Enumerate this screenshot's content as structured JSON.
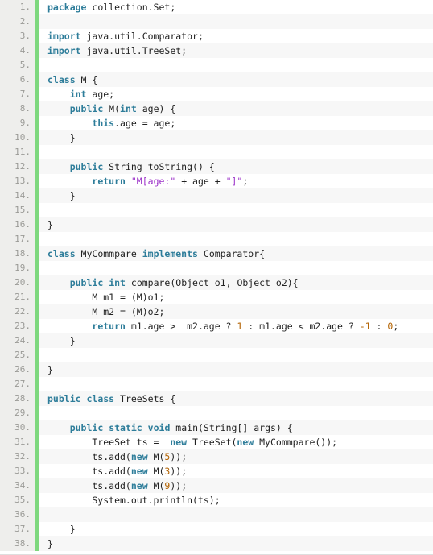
{
  "editor": {
    "language": "java",
    "line_number_suffix": ".",
    "colors": {
      "background": "#ffffff",
      "stripe": "#f7f7f7",
      "gutter_background": "#eeeeec",
      "gutter_text": "#9a9a96",
      "change_marker": "#7ed87e",
      "keyword": "#2e7d9a",
      "string": "#9b30c8",
      "number": "#b36200",
      "plain_text": "#222222"
    },
    "first_line": 1,
    "last_line": 38,
    "total_lines": 38
  },
  "lines": [
    {
      "n": "1.",
      "tokens": [
        {
          "t": "package",
          "c": "kw"
        },
        {
          "t": " collection.Set;",
          "c": "plain"
        }
      ]
    },
    {
      "n": "2.",
      "tokens": []
    },
    {
      "n": "3.",
      "tokens": [
        {
          "t": "import",
          "c": "kw"
        },
        {
          "t": " java.util.Comparator;",
          "c": "plain"
        }
      ]
    },
    {
      "n": "4.",
      "tokens": [
        {
          "t": "import",
          "c": "kw"
        },
        {
          "t": " java.util.TreeSet;",
          "c": "plain"
        }
      ]
    },
    {
      "n": "5.",
      "tokens": []
    },
    {
      "n": "6.",
      "tokens": [
        {
          "t": "class",
          "c": "kw"
        },
        {
          "t": " M {",
          "c": "plain"
        }
      ]
    },
    {
      "n": "7.",
      "tokens": [
        {
          "t": "    ",
          "c": "plain"
        },
        {
          "t": "int",
          "c": "kw"
        },
        {
          "t": " age;",
          "c": "plain"
        }
      ]
    },
    {
      "n": "8.",
      "tokens": [
        {
          "t": "    ",
          "c": "plain"
        },
        {
          "t": "public",
          "c": "kw"
        },
        {
          "t": " M(",
          "c": "plain"
        },
        {
          "t": "int",
          "c": "kw"
        },
        {
          "t": " age) {",
          "c": "plain"
        }
      ]
    },
    {
      "n": "9.",
      "tokens": [
        {
          "t": "        ",
          "c": "plain"
        },
        {
          "t": "this",
          "c": "kw"
        },
        {
          "t": ".age = age;",
          "c": "plain"
        }
      ]
    },
    {
      "n": "10.",
      "tokens": [
        {
          "t": "    }",
          "c": "plain"
        }
      ]
    },
    {
      "n": "11.",
      "tokens": []
    },
    {
      "n": "12.",
      "tokens": [
        {
          "t": "    ",
          "c": "plain"
        },
        {
          "t": "public",
          "c": "kw"
        },
        {
          "t": " String toString() {",
          "c": "plain"
        }
      ]
    },
    {
      "n": "13.",
      "tokens": [
        {
          "t": "        ",
          "c": "plain"
        },
        {
          "t": "return",
          "c": "kw"
        },
        {
          "t": " ",
          "c": "plain"
        },
        {
          "t": "\"M[age:\"",
          "c": "str"
        },
        {
          "t": " + age + ",
          "c": "plain"
        },
        {
          "t": "\"]\"",
          "c": "str"
        },
        {
          "t": ";",
          "c": "plain"
        }
      ]
    },
    {
      "n": "14.",
      "tokens": [
        {
          "t": "    }",
          "c": "plain"
        }
      ]
    },
    {
      "n": "15.",
      "tokens": []
    },
    {
      "n": "16.",
      "tokens": [
        {
          "t": "}",
          "c": "plain"
        }
      ]
    },
    {
      "n": "17.",
      "tokens": []
    },
    {
      "n": "18.",
      "tokens": [
        {
          "t": "class",
          "c": "kw"
        },
        {
          "t": " MyCommpare ",
          "c": "plain"
        },
        {
          "t": "implements",
          "c": "kw"
        },
        {
          "t": " Comparator{",
          "c": "plain"
        }
      ]
    },
    {
      "n": "19.",
      "tokens": []
    },
    {
      "n": "20.",
      "tokens": [
        {
          "t": "    ",
          "c": "plain"
        },
        {
          "t": "public",
          "c": "kw"
        },
        {
          "t": " ",
          "c": "plain"
        },
        {
          "t": "int",
          "c": "kw"
        },
        {
          "t": " compare(Object o1, Object o2){",
          "c": "plain"
        }
      ]
    },
    {
      "n": "21.",
      "tokens": [
        {
          "t": "        M m1 = (M)o1;",
          "c": "plain"
        }
      ]
    },
    {
      "n": "22.",
      "tokens": [
        {
          "t": "        M m2 = (M)o2;",
          "c": "plain"
        }
      ]
    },
    {
      "n": "23.",
      "tokens": [
        {
          "t": "        ",
          "c": "plain"
        },
        {
          "t": "return",
          "c": "kw"
        },
        {
          "t": " m1.age >  m2.age ? ",
          "c": "plain"
        },
        {
          "t": "1",
          "c": "num"
        },
        {
          "t": " : m1.age < m2.age ? ",
          "c": "plain"
        },
        {
          "t": "-1",
          "c": "num"
        },
        {
          "t": " : ",
          "c": "plain"
        },
        {
          "t": "0",
          "c": "num"
        },
        {
          "t": ";",
          "c": "plain"
        }
      ]
    },
    {
      "n": "24.",
      "tokens": [
        {
          "t": "    }",
          "c": "plain"
        }
      ]
    },
    {
      "n": "25.",
      "tokens": []
    },
    {
      "n": "26.",
      "tokens": [
        {
          "t": "}",
          "c": "plain"
        }
      ]
    },
    {
      "n": "27.",
      "tokens": []
    },
    {
      "n": "28.",
      "tokens": [
        {
          "t": "public",
          "c": "kw"
        },
        {
          "t": " ",
          "c": "plain"
        },
        {
          "t": "class",
          "c": "kw"
        },
        {
          "t": " TreeSets {",
          "c": "plain"
        }
      ]
    },
    {
      "n": "29.",
      "tokens": []
    },
    {
      "n": "30.",
      "tokens": [
        {
          "t": "    ",
          "c": "plain"
        },
        {
          "t": "public",
          "c": "kw"
        },
        {
          "t": " ",
          "c": "plain"
        },
        {
          "t": "static",
          "c": "kw"
        },
        {
          "t": " ",
          "c": "plain"
        },
        {
          "t": "void",
          "c": "kw"
        },
        {
          "t": " main(String[] args) {",
          "c": "plain"
        }
      ]
    },
    {
      "n": "31.",
      "tokens": [
        {
          "t": "        TreeSet ts =  ",
          "c": "plain"
        },
        {
          "t": "new",
          "c": "kw"
        },
        {
          "t": " TreeSet(",
          "c": "plain"
        },
        {
          "t": "new",
          "c": "kw"
        },
        {
          "t": " MyCommpare());",
          "c": "plain"
        }
      ]
    },
    {
      "n": "32.",
      "tokens": [
        {
          "t": "        ts.add(",
          "c": "plain"
        },
        {
          "t": "new",
          "c": "kw"
        },
        {
          "t": " M(",
          "c": "plain"
        },
        {
          "t": "5",
          "c": "num"
        },
        {
          "t": "));",
          "c": "plain"
        }
      ]
    },
    {
      "n": "33.",
      "tokens": [
        {
          "t": "        ts.add(",
          "c": "plain"
        },
        {
          "t": "new",
          "c": "kw"
        },
        {
          "t": " M(",
          "c": "plain"
        },
        {
          "t": "3",
          "c": "num"
        },
        {
          "t": "));",
          "c": "plain"
        }
      ]
    },
    {
      "n": "34.",
      "tokens": [
        {
          "t": "        ts.add(",
          "c": "plain"
        },
        {
          "t": "new",
          "c": "kw"
        },
        {
          "t": " M(",
          "c": "plain"
        },
        {
          "t": "9",
          "c": "num"
        },
        {
          "t": "));",
          "c": "plain"
        }
      ]
    },
    {
      "n": "35.",
      "tokens": [
        {
          "t": "        System.out.println(ts);",
          "c": "plain"
        }
      ]
    },
    {
      "n": "36.",
      "tokens": []
    },
    {
      "n": "37.",
      "tokens": [
        {
          "t": "    }",
          "c": "plain"
        }
      ]
    },
    {
      "n": "38.",
      "tokens": [
        {
          "t": "}",
          "c": "plain"
        }
      ]
    }
  ]
}
